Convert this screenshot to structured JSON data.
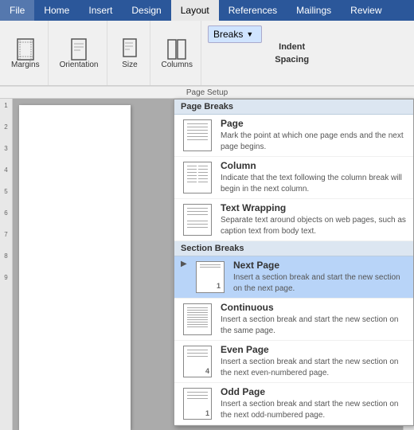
{
  "tabs": [
    {
      "label": "File",
      "active": false
    },
    {
      "label": "Home",
      "active": false
    },
    {
      "label": "Insert",
      "active": false
    },
    {
      "label": "Design",
      "active": false
    },
    {
      "label": "Layout",
      "active": true
    },
    {
      "label": "References",
      "active": false
    },
    {
      "label": "Mailings",
      "active": false
    },
    {
      "label": "Review",
      "active": false
    }
  ],
  "ribbon": {
    "groups": [
      {
        "label": "Margins",
        "icon": "▭"
      },
      {
        "label": "Orientation",
        "icon": "⬜"
      },
      {
        "label": "Size",
        "icon": "📄"
      },
      {
        "label": "Columns",
        "icon": "⫿"
      }
    ],
    "breaks_label": "Breaks",
    "indent_label": "Indent",
    "spacing_label": "Spacing",
    "page_setup_label": "Page Setup"
  },
  "dropdown": {
    "page_breaks_header": "Page Breaks",
    "section_breaks_header": "Section Breaks",
    "items": [
      {
        "id": "page",
        "title": "Page",
        "desc": "Mark the point at which one page ends and the next page begins.",
        "selected": false
      },
      {
        "id": "column",
        "title": "Column",
        "desc": "Indicate that the text following the column break will begin in the next column.",
        "selected": false
      },
      {
        "id": "text-wrapping",
        "title": "Text Wrapping",
        "desc": "Separate text around objects on web pages, such as caption text from body text.",
        "selected": false
      },
      {
        "id": "next-page",
        "title": "Next Page",
        "desc": "Insert a section break and start the new section on the next page.",
        "selected": true
      },
      {
        "id": "continuous",
        "title": "Continuous",
        "desc": "Insert a section break and start the new section on the same page.",
        "selected": false
      },
      {
        "id": "even-page",
        "title": "Even Page",
        "desc": "Insert a section break and start the new section on the next even-numbered page.",
        "selected": false
      },
      {
        "id": "odd-page",
        "title": "Odd Page",
        "desc": "Insert a section break and start the new section on the next odd-numbered page.",
        "selected": false
      }
    ]
  }
}
